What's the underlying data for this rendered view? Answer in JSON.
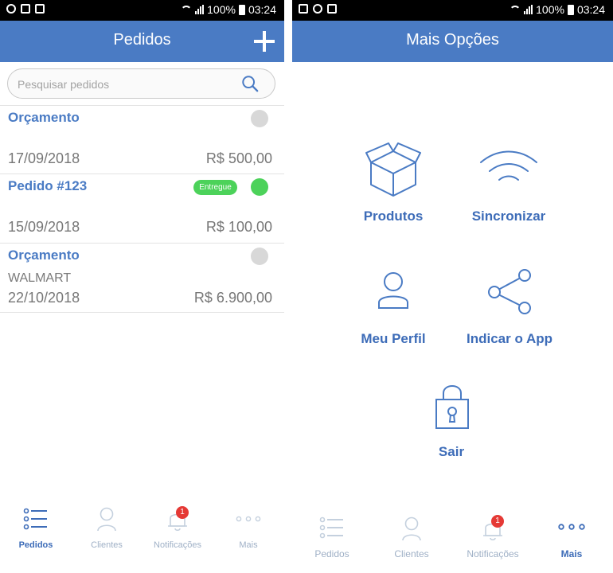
{
  "status_left": {
    "battery_pct": "100%",
    "time": "03:24"
  },
  "status_right": {
    "battery_pct": "100%",
    "time": "03:24"
  },
  "pedidos": {
    "title": "Pedidos",
    "search_placeholder": "Pesquisar pedidos",
    "orders": [
      {
        "title": "Orçamento",
        "status": "",
        "badge": "",
        "date": "17/09/2018",
        "value": "R$ 500,00",
        "dot": "gray"
      },
      {
        "title": "Pedido #123",
        "status": "",
        "badge": "Entregue",
        "date": "15/09/2018",
        "value": "R$ 100,00",
        "dot": "green"
      },
      {
        "title": "Orçamento",
        "status": "WALMART",
        "badge": "",
        "date": "22/10/2018",
        "value": "R$ 6.900,00",
        "dot": "gray"
      }
    ],
    "tabs": [
      {
        "label": "Pedidos",
        "icon": "list-icon",
        "active": true
      },
      {
        "label": "Clientes",
        "icon": "user-icon",
        "active": false
      },
      {
        "label": "Notificações",
        "icon": "bell-icon",
        "active": false,
        "count": "1"
      },
      {
        "label": "Mais",
        "icon": "more-icon",
        "active": false
      }
    ]
  },
  "mais": {
    "title": "Mais Opções",
    "options": [
      {
        "label": "Produtos",
        "icon": "box-icon"
      },
      {
        "label": "Sincronizar",
        "icon": "wifi-icon"
      },
      {
        "label": "Meu Perfil",
        "icon": "profile-icon"
      },
      {
        "label": "Indicar o App",
        "icon": "share-icon"
      },
      {
        "label": "Sair",
        "icon": "lock-icon"
      }
    ],
    "tabs": [
      {
        "label": "Pedidos",
        "icon": "list-icon",
        "active": false
      },
      {
        "label": "Clientes",
        "icon": "user-icon",
        "active": false
      },
      {
        "label": "Notificações",
        "icon": "bell-icon",
        "active": false,
        "count": "1"
      },
      {
        "label": "Mais",
        "icon": "more-icon",
        "active": true
      }
    ]
  },
  "colors": {
    "primary": "#4a7bc4",
    "accent_text": "#3d6cb8",
    "delivered": "#4cd25a",
    "notification": "#e53935"
  }
}
